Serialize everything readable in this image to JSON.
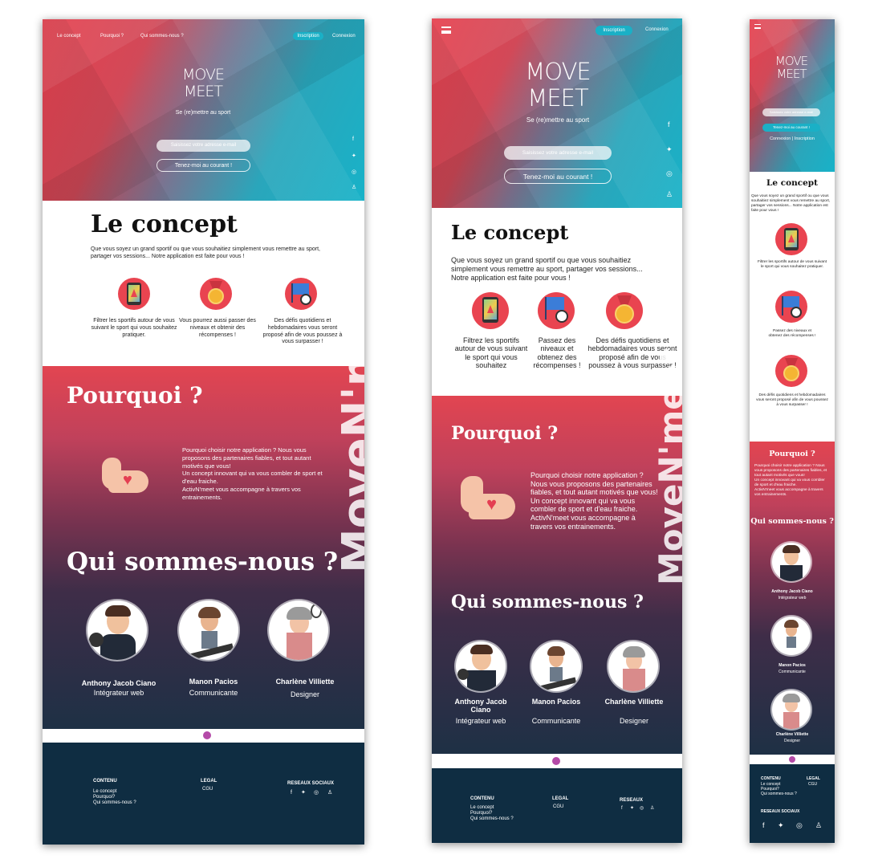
{
  "brand": {
    "logo_top": "MOVE",
    "logo_bottom": "MEET",
    "tagline": "Se (re)mettre au sport",
    "watermark": "MoveN'meet"
  },
  "nav": {
    "concept": "Le concept",
    "pourquoi": "Pourquoi ?",
    "qui": "Qui sommes-nous ?",
    "inscription": "Inscription",
    "connexion": "Connexion",
    "mobile_links": "Connexion | Inscription"
  },
  "hero": {
    "email_placeholder": "Saisissez votre adresse e-mail",
    "cta": "Tenez-moi au courant !"
  },
  "concept": {
    "title": "Le concept",
    "intro": "Que vous soyez un grand sportif ou que vous souhaitiez simplement vous remettre au sport, partager vos sessions... Notre application est faite pour vous !",
    "f1_a": "Filtrer les sportifs autour de vous suivant le sport qui vous souhaitez pratiquer.",
    "f1_b": "Filtrez les sportifs autour de vous suivant le sport qui vous souhaitez",
    "f2_a": "Vous pourrez aussi passer des niveaux et obtenir des récompenses !",
    "f2_b": "Passez des niveaux et obtenez des récompenses !",
    "f3": "Des défis quotidiens et hebdomadaires vous seront proposé afin de vous poussez à vous surpasser !"
  },
  "pourquoi": {
    "title": "Pourquoi ?",
    "p1": "Pourquoi choisir notre application ? Nous vous proposons des partenaires fiables, et tout autant motivés que vous!",
    "p2": "Un concept innovant qui va vous combler de sport et d'eau fraiche.",
    "p3": "ActivN'meet vous accompagne à travers vos entrainements."
  },
  "team": {
    "title": "Qui sommes-nous ?",
    "members": [
      {
        "name": "Anthony Jacob Ciano",
        "role": "Intégrateur web"
      },
      {
        "name": "Manon Pacios",
        "role": "Communicante"
      },
      {
        "name": "Charlène Villiette",
        "role": "Designer"
      }
    ]
  },
  "footer": {
    "contenu": "CONTENU",
    "legal": "LEGAL",
    "reseaux": "RESEAUX SOCIAUX",
    "reseaux_short": "RESEAUX",
    "cgu": "CGU",
    "l1": "Le concept",
    "l2": "Pourquoi?",
    "l3": "Qui sommes-nous ?"
  },
  "colors": {
    "red": "#e6404e",
    "teal": "#18b2c8",
    "navy": "#0f2d42",
    "accent": "#1ab0c6"
  }
}
